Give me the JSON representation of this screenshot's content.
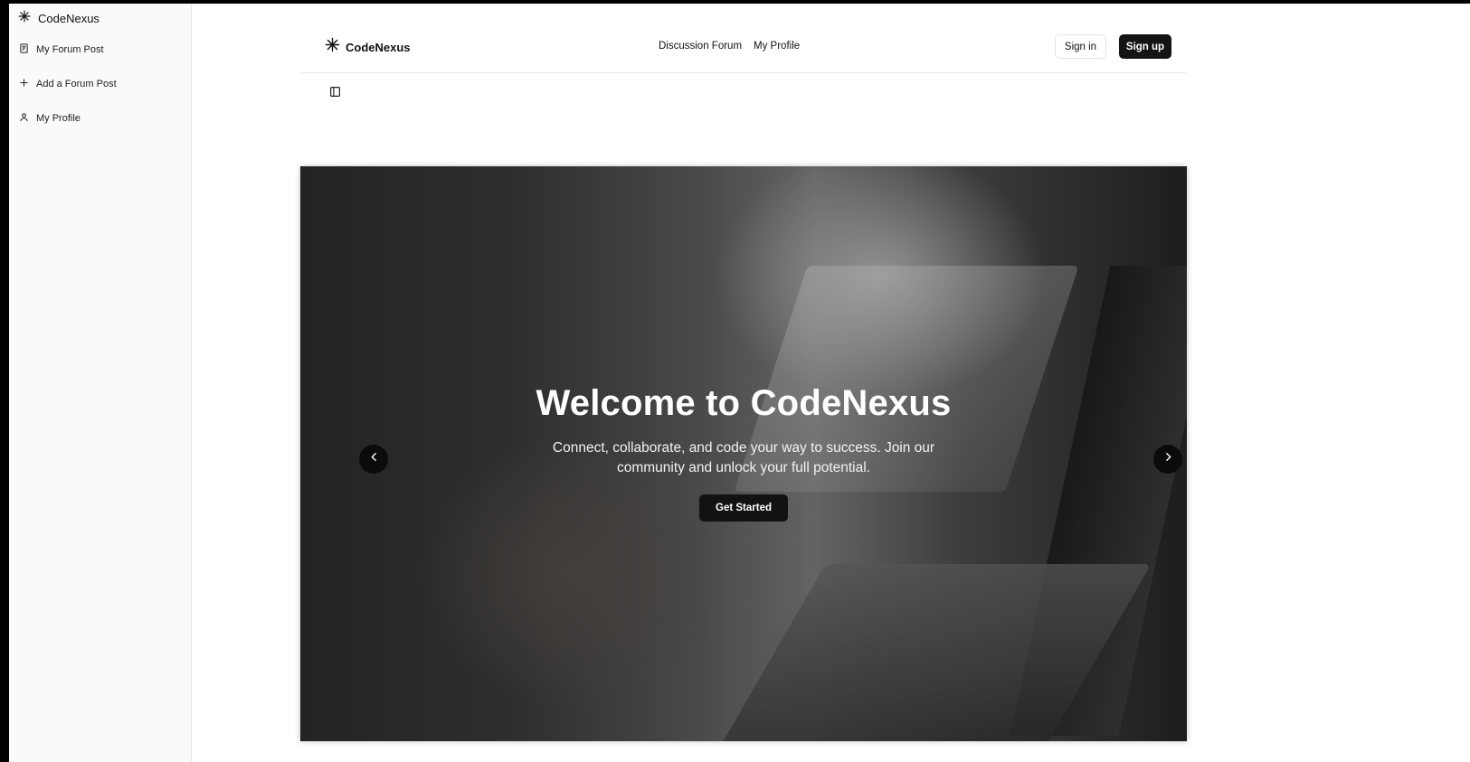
{
  "sidebar": {
    "brand": "CodeNexus",
    "items": [
      {
        "label": "My Forum Post",
        "icon": "notebook-icon"
      },
      {
        "label": "Add a Forum Post",
        "icon": "plus-icon"
      },
      {
        "label": "My Profile",
        "icon": "user-icon"
      }
    ]
  },
  "header": {
    "brand": "CodeNexus",
    "nav": [
      "Discussion Forum",
      "My Profile"
    ],
    "signin_label": "Sign in",
    "signup_label": "Sign up"
  },
  "hero": {
    "title": "Welcome to CodeNexus",
    "subtitle": "Connect, collaborate, and code your way to success. Join our community and unlock your full potential.",
    "cta_label": "Get Started"
  },
  "colors": {
    "primary_button": "#141414",
    "sidebar_bg": "#fafafa",
    "page_bg": "#ffffff"
  }
}
